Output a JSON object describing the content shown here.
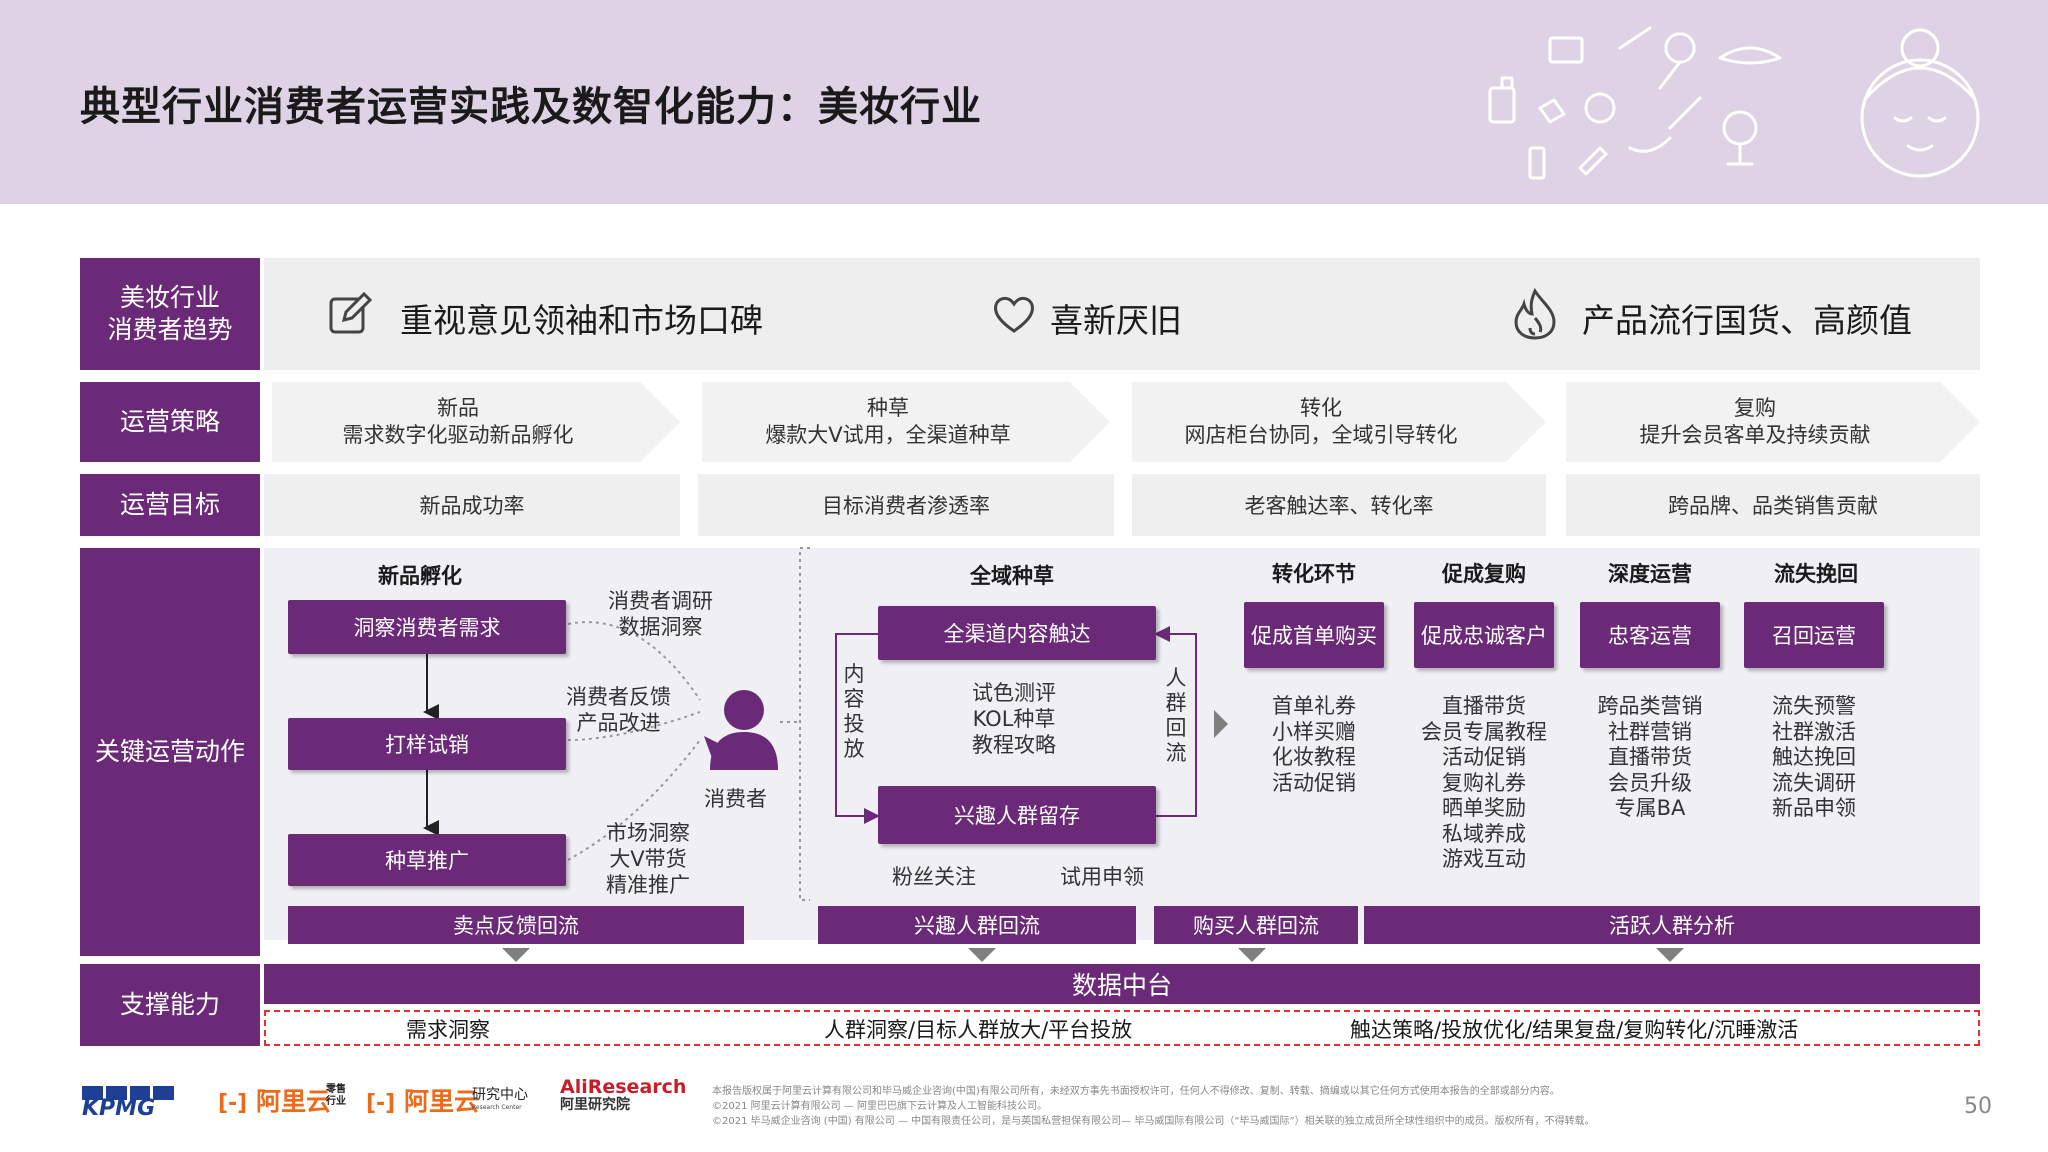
{
  "title": "典型行业消费者运营实践及数智化能力：美妆行业",
  "row_labels": {
    "trend": [
      "美妆行业",
      "消费者趋势"
    ],
    "strategy": "运营策略",
    "goal": "运营目标",
    "action": "关键运营动作",
    "support": "支撑能力"
  },
  "trends": [
    {
      "icon": "edit-icon",
      "text": "重视意见领袖和市场口碑"
    },
    {
      "icon": "heart-icon",
      "text": "喜新厌旧"
    },
    {
      "icon": "flame-icon",
      "text": "产品流行国货、高颜值"
    }
  ],
  "strategies": [
    {
      "title": "新品",
      "desc": "需求数字化驱动新品孵化"
    },
    {
      "title": "种草",
      "desc": "爆款大V试用，全渠道种草"
    },
    {
      "title": "转化",
      "desc": "网店柜台协同，全域引导转化"
    },
    {
      "title": "复购",
      "desc": "提升会员客单及持续贡献"
    }
  ],
  "goals": [
    "新品成功率",
    "目标消费者渗透率",
    "老客触达率、转化率",
    "跨品牌、品类销售贡献"
  ],
  "incubation": {
    "title": "新品孵化",
    "steps": [
      "洞察消费者需求",
      "打样试销",
      "种草推广"
    ],
    "notes": [
      [
        "消费者调研",
        "数据洞察"
      ],
      [
        "消费者反馈",
        "产品改进"
      ],
      [
        "市场洞察",
        "大V带货",
        "精准推广"
      ]
    ],
    "consumer_label": "消费者"
  },
  "seeding": {
    "title": "全域种草",
    "top_box": "全渠道内容触达",
    "bottom_box": "兴趣人群留存",
    "left_vertical": "内容投放",
    "right_vertical": "人群回流",
    "middle": [
      "试色测评",
      "KOL种草",
      "教程攻略"
    ],
    "bottom_left": "粉丝关注",
    "bottom_right": "试用申领"
  },
  "stages": [
    {
      "title": "转化环节",
      "box": "促成首单购买",
      "items": [
        "首单礼券",
        "小样买赠",
        "化妆教程",
        "活动促销"
      ]
    },
    {
      "title": "促成复购",
      "box": "促成忠诚客户",
      "items": [
        "直播带货",
        "会员专属教程",
        "活动促销",
        "复购礼券",
        "晒单奖励",
        "私域养成",
        "游戏互动"
      ]
    },
    {
      "title": "深度运营",
      "box": "忠客运营",
      "items": [
        "跨品类营销",
        "社群营销",
        "直播带货",
        "会员升级",
        "专属BA"
      ]
    },
    {
      "title": "流失挽回",
      "box": "召回运营",
      "items": [
        "流失预警",
        "社群激活",
        "触达挽回",
        "流失调研",
        "新品申领"
      ]
    }
  ],
  "feedback_bars": [
    "卖点反馈回流",
    "兴趣人群回流",
    "购买人群回流",
    "活跃人群分析"
  ],
  "support": {
    "hub": "数据中台",
    "items": [
      "需求洞察",
      "人群洞察/目标人群放大/平台投放",
      "触达策略/投放优化/结果复盘/复购转化/沉睡激活"
    ]
  },
  "footer": {
    "kpmg": "KPMG",
    "aliyun_retail": "阿里云",
    "aliyun_retail_tag": [
      "零售",
      "行业"
    ],
    "aliyun_research": "阿里云",
    "aliyun_research_tag": "研究中心",
    "aliyun_research_sub": "Research Center",
    "ali_research": "AliResearch",
    "ali_research_cn": "阿里研究院",
    "copyright": [
      "本报告版权属于阿里云计算有限公司和毕马威企业咨询(中国)有限公司所有，未经双方事先书面授权许可，任何人不得修改、复制、转载、摘编或以其它任何方式使用本报告的全部或部分内容。",
      "©2021 阿里云计算有限公司 — 阿里巴巴旗下云计算及人工智能科技公司。",
      "©2021 毕马威企业咨询 (中国) 有限公司 — 中国有限责任公司，是与英国私营担保有限公司— 毕马威国际有限公司（“毕马威国际”）相关联的独立成员所全球性组织中的成员。版权所有，不得转载。"
    ],
    "page": "50"
  },
  "colors": {
    "purple": "#6b2a78",
    "header_bg": "#ddd3e5",
    "dashed_red": "#e03030",
    "orange": "#ee6a1b",
    "kpmg_blue": "#1e3f93"
  }
}
